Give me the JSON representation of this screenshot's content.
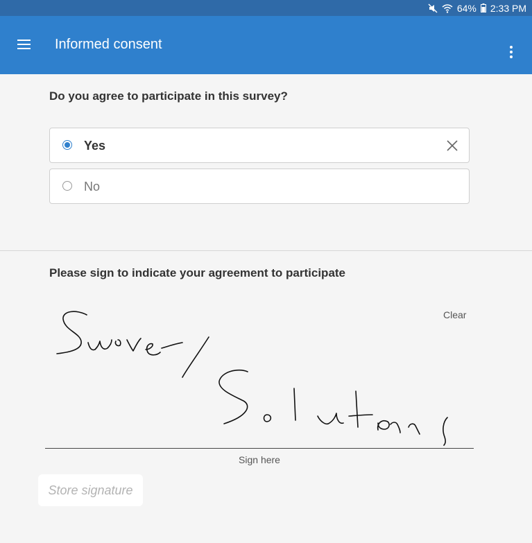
{
  "status_bar": {
    "battery_level": "64%",
    "time": "2:33 PM",
    "icons": [
      "mute-icon",
      "wifi-icon",
      "battery-icon"
    ]
  },
  "app_bar": {
    "title": "Informed consent",
    "icons": [
      "menu-icon",
      "more-vert-icon"
    ]
  },
  "consent_question": {
    "text": "Do you agree to participate in this survey?",
    "options": [
      {
        "label": "Yes",
        "selected": true
      },
      {
        "label": "No",
        "selected": false
      }
    ]
  },
  "signature": {
    "prompt": "Please sign to indicate your agreement to participate",
    "clear_label": "Clear",
    "sign_here_label": "Sign here",
    "store_button_label": "Store signature"
  },
  "colors": {
    "status_bar": "#2f6aa8",
    "app_bar": "#2f80cd",
    "accent": "#2f80cd",
    "background": "#f5f5f5"
  }
}
